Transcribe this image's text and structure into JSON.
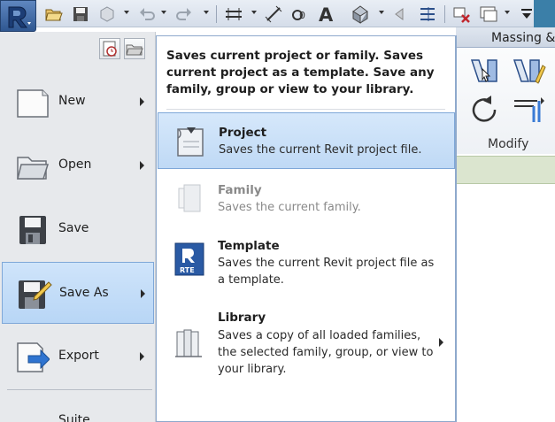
{
  "ribbon": {
    "tab_massing": "Massing &",
    "modify_label": "Modify"
  },
  "app_menu": {
    "items": [
      {
        "label": "New",
        "icon": "new-document-icon",
        "has_submenu": true
      },
      {
        "label": "Open",
        "icon": "open-folder-icon",
        "has_submenu": true
      },
      {
        "label": "Save",
        "icon": "floppy-disk-icon",
        "has_submenu": false
      },
      {
        "label": "Save As",
        "icon": "save-as-icon",
        "has_submenu": true
      },
      {
        "label": "Export",
        "icon": "export-icon",
        "has_submenu": true
      }
    ],
    "partial_item": "Suite"
  },
  "submenu": {
    "tooltip": "Saves current project or family. Saves current project as a template. Save any family, group or view to your library.",
    "items": [
      {
        "title": "Project",
        "desc": "Saves the current Revit project file.",
        "icon": "project-icon",
        "state": "selected"
      },
      {
        "title": "Family",
        "desc": "Saves the current family.",
        "icon": "family-icon",
        "state": "disabled"
      },
      {
        "title": "Template",
        "desc": "Saves the current Revit project file as a template.",
        "icon": "rte-template-icon",
        "icon_text": "RTE",
        "state": "normal"
      },
      {
        "title": "Library",
        "desc": "Saves a copy of all loaded families, the selected family, group, or view to your library.",
        "icon": "library-books-icon",
        "state": "normal"
      }
    ]
  },
  "colors": {
    "selection_fill": "#c6dff8",
    "selection_border": "#7ea7d8",
    "app_button": "#3a64a0"
  }
}
